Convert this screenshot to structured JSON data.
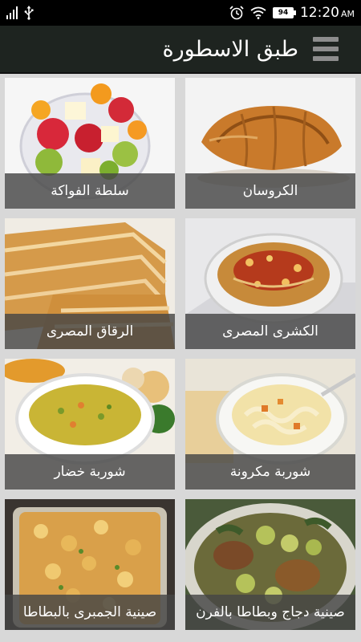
{
  "status_bar": {
    "battery": "94",
    "time": "12:20",
    "ampm": "AM"
  },
  "app": {
    "title": "طبق الاسطورة"
  },
  "recipes": [
    {
      "label": "الكروسان",
      "image": "croissant"
    },
    {
      "label": "سلطة الفواكة",
      "image": "fruit-salad"
    },
    {
      "label": "الكشرى المصرى",
      "image": "koshari"
    },
    {
      "label": "الرقاق المصرى",
      "image": "roqaq-pastry"
    },
    {
      "label": "شوربة مكرونة",
      "image": "noodle-soup"
    },
    {
      "label": "شوربة خضار",
      "image": "vegetable-soup"
    },
    {
      "label": "صينية دجاج وبطاطا بالفرن",
      "image": "baked-chicken-potato"
    },
    {
      "label": "صينية الجمبرى بالبطاطا",
      "image": "shrimp-potato-tray"
    }
  ]
}
